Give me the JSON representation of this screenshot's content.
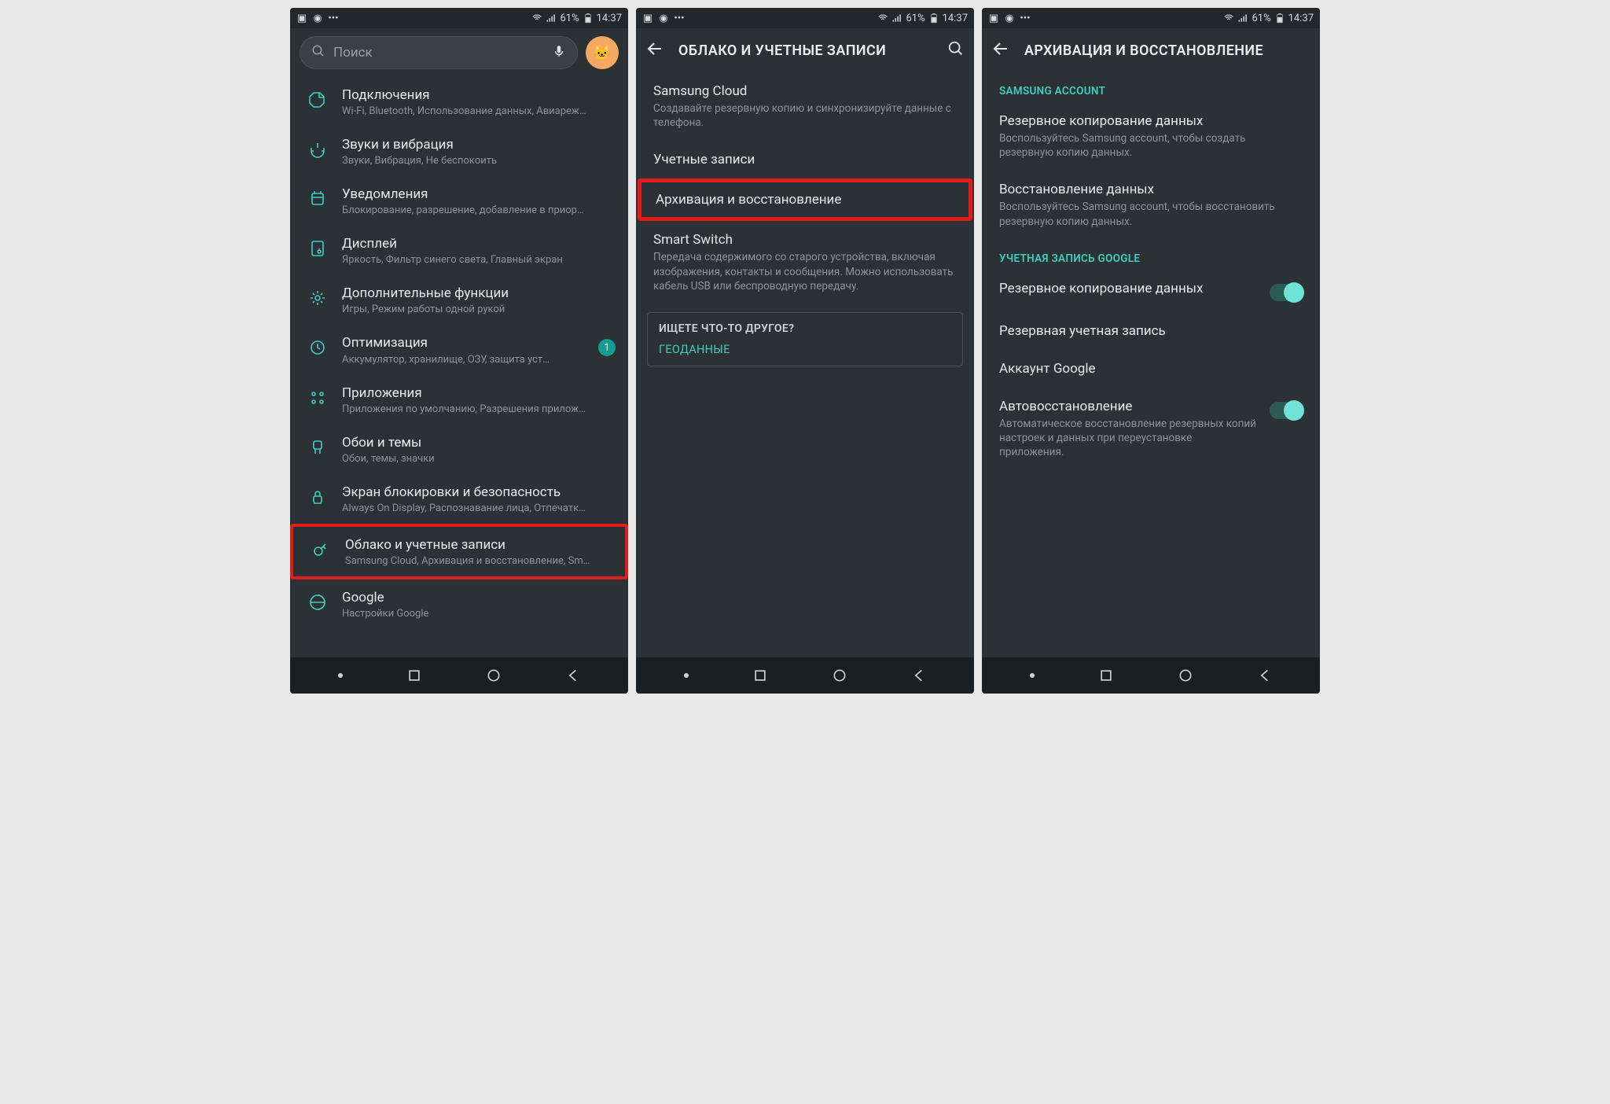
{
  "status": {
    "battery": "61%",
    "time": "14:37"
  },
  "screen1": {
    "search_placeholder": "Поиск",
    "items": [
      {
        "title": "Подключения",
        "sub": "Wi-Fi, Bluetooth, Использование данных, Авиареж…"
      },
      {
        "title": "Звуки и вибрация",
        "sub": "Звуки, Вибрация, Не беспокоить"
      },
      {
        "title": "Уведомления",
        "sub": "Блокирование, разрешение, добавление в приор…"
      },
      {
        "title": "Дисплей",
        "sub": "Яркость, Фильтр синего света, Главный экран"
      },
      {
        "title": "Дополнительные функции",
        "sub": "Игры, Режим работы одной рукой"
      },
      {
        "title": "Оптимизация",
        "sub": "Аккумулятор, хранилище, ОЗУ, защита уст…",
        "badge": "1"
      },
      {
        "title": "Приложения",
        "sub": "Приложения по умолчанию, Разрешения прилож…"
      },
      {
        "title": "Обои и темы",
        "sub": "Обои, темы, значки"
      },
      {
        "title": "Экран блокировки и безопасность",
        "sub": "Always On Display, Распознавание лица, Отпечатк…"
      },
      {
        "title": "Облако и учетные записи",
        "sub": "Samsung Cloud, Архивация и восстановление, Sm…",
        "hl": true
      },
      {
        "title": "Google",
        "sub": "Настройки Google"
      }
    ]
  },
  "screen2": {
    "header": "ОБЛАКО И УЧЕТНЫЕ ЗАПИСИ",
    "entries": [
      {
        "title": "Samsung Cloud",
        "sub": "Создавайте резервную копию и синхронизируйте данные с телефона."
      },
      {
        "title": "Учетные записи"
      },
      {
        "title": "Архивация и восстановление",
        "hl": true
      },
      {
        "title": "Smart Switch",
        "sub": "Передача содержимого со старого устройства, включая изображения, контакты и сообщения. Можно использовать кабель USB или беспроводную передачу."
      }
    ],
    "suggest_head": "ИЩЕТЕ ЧТО-ТО ДРУГОЕ?",
    "suggest_link": "ГЕОДАННЫЕ"
  },
  "screen3": {
    "header": "АРХИВАЦИЯ И ВОССТАНОВЛЕНИЕ",
    "section1": "SAMSUNG ACCOUNT",
    "s1_items": [
      {
        "title": "Резервное копирование данных",
        "sub": "Воспользуйтесь Samsung account, чтобы создать резервную копию данных."
      },
      {
        "title": "Восстановление данных",
        "sub": "Воспользуйтесь Samsung account, чтобы восстановить резервную копию данных."
      }
    ],
    "section2": "УЧЕТНАЯ ЗАПИСЬ GOOGLE",
    "s2_items": [
      {
        "title": "Резервное копирование данных",
        "toggle": true
      },
      {
        "title": "Резервная учетная запись"
      },
      {
        "title": "Аккаунт Google"
      },
      {
        "title": "Автовосстановление",
        "sub": "Автоматическое восстановление резервных копий настроек и данных при переустановке приложения.",
        "toggle": true
      }
    ]
  }
}
